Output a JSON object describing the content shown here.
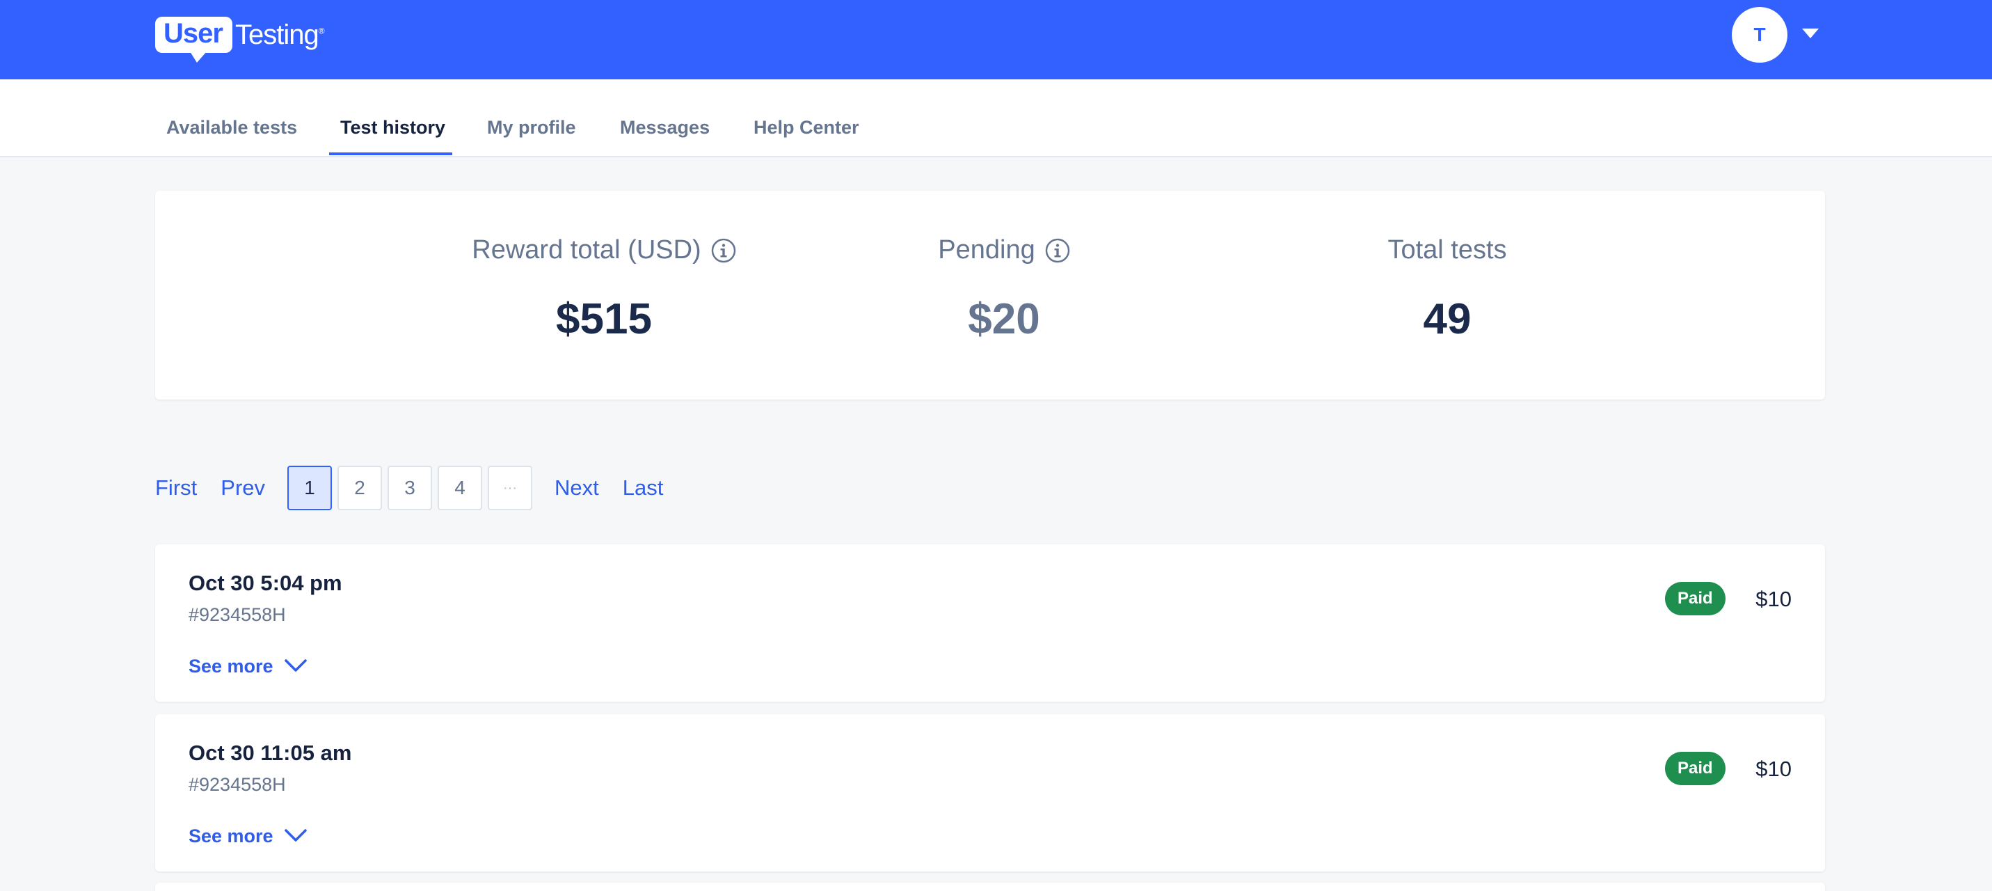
{
  "header": {
    "logo_user": "User",
    "logo_testing": "Testing",
    "logo_mark": "®",
    "avatar_initial": "T",
    "brand_color": "#3361ff"
  },
  "tabs": [
    {
      "label": "Available tests",
      "active": false
    },
    {
      "label": "Test history",
      "active": true
    },
    {
      "label": "My profile",
      "active": false
    },
    {
      "label": "Messages",
      "active": false
    },
    {
      "label": "Help Center",
      "active": false
    }
  ],
  "summary": {
    "reward": {
      "label": "Reward total (USD)",
      "value": "$515",
      "icon": "info-icon"
    },
    "pending": {
      "label": "Pending",
      "value": "$20",
      "icon": "info-icon"
    },
    "total": {
      "label": "Total tests",
      "value": "49"
    }
  },
  "pagination": {
    "first": "First",
    "prev": "Prev",
    "pages": [
      "1",
      "2",
      "3",
      "4",
      "···"
    ],
    "current": "1",
    "next": "Next",
    "last": "Last"
  },
  "history": [
    {
      "date": "Oct 30 5:04 pm",
      "id": "#9234558H",
      "see_more": "See more",
      "status": "Paid",
      "amount": "$10",
      "status_color": "#1e8f4e"
    },
    {
      "date": "Oct 30 11:05 am",
      "id": "#9234558H",
      "see_more": "See more",
      "status": "Paid",
      "amount": "$10",
      "status_color": "#1e8f4e"
    }
  ]
}
